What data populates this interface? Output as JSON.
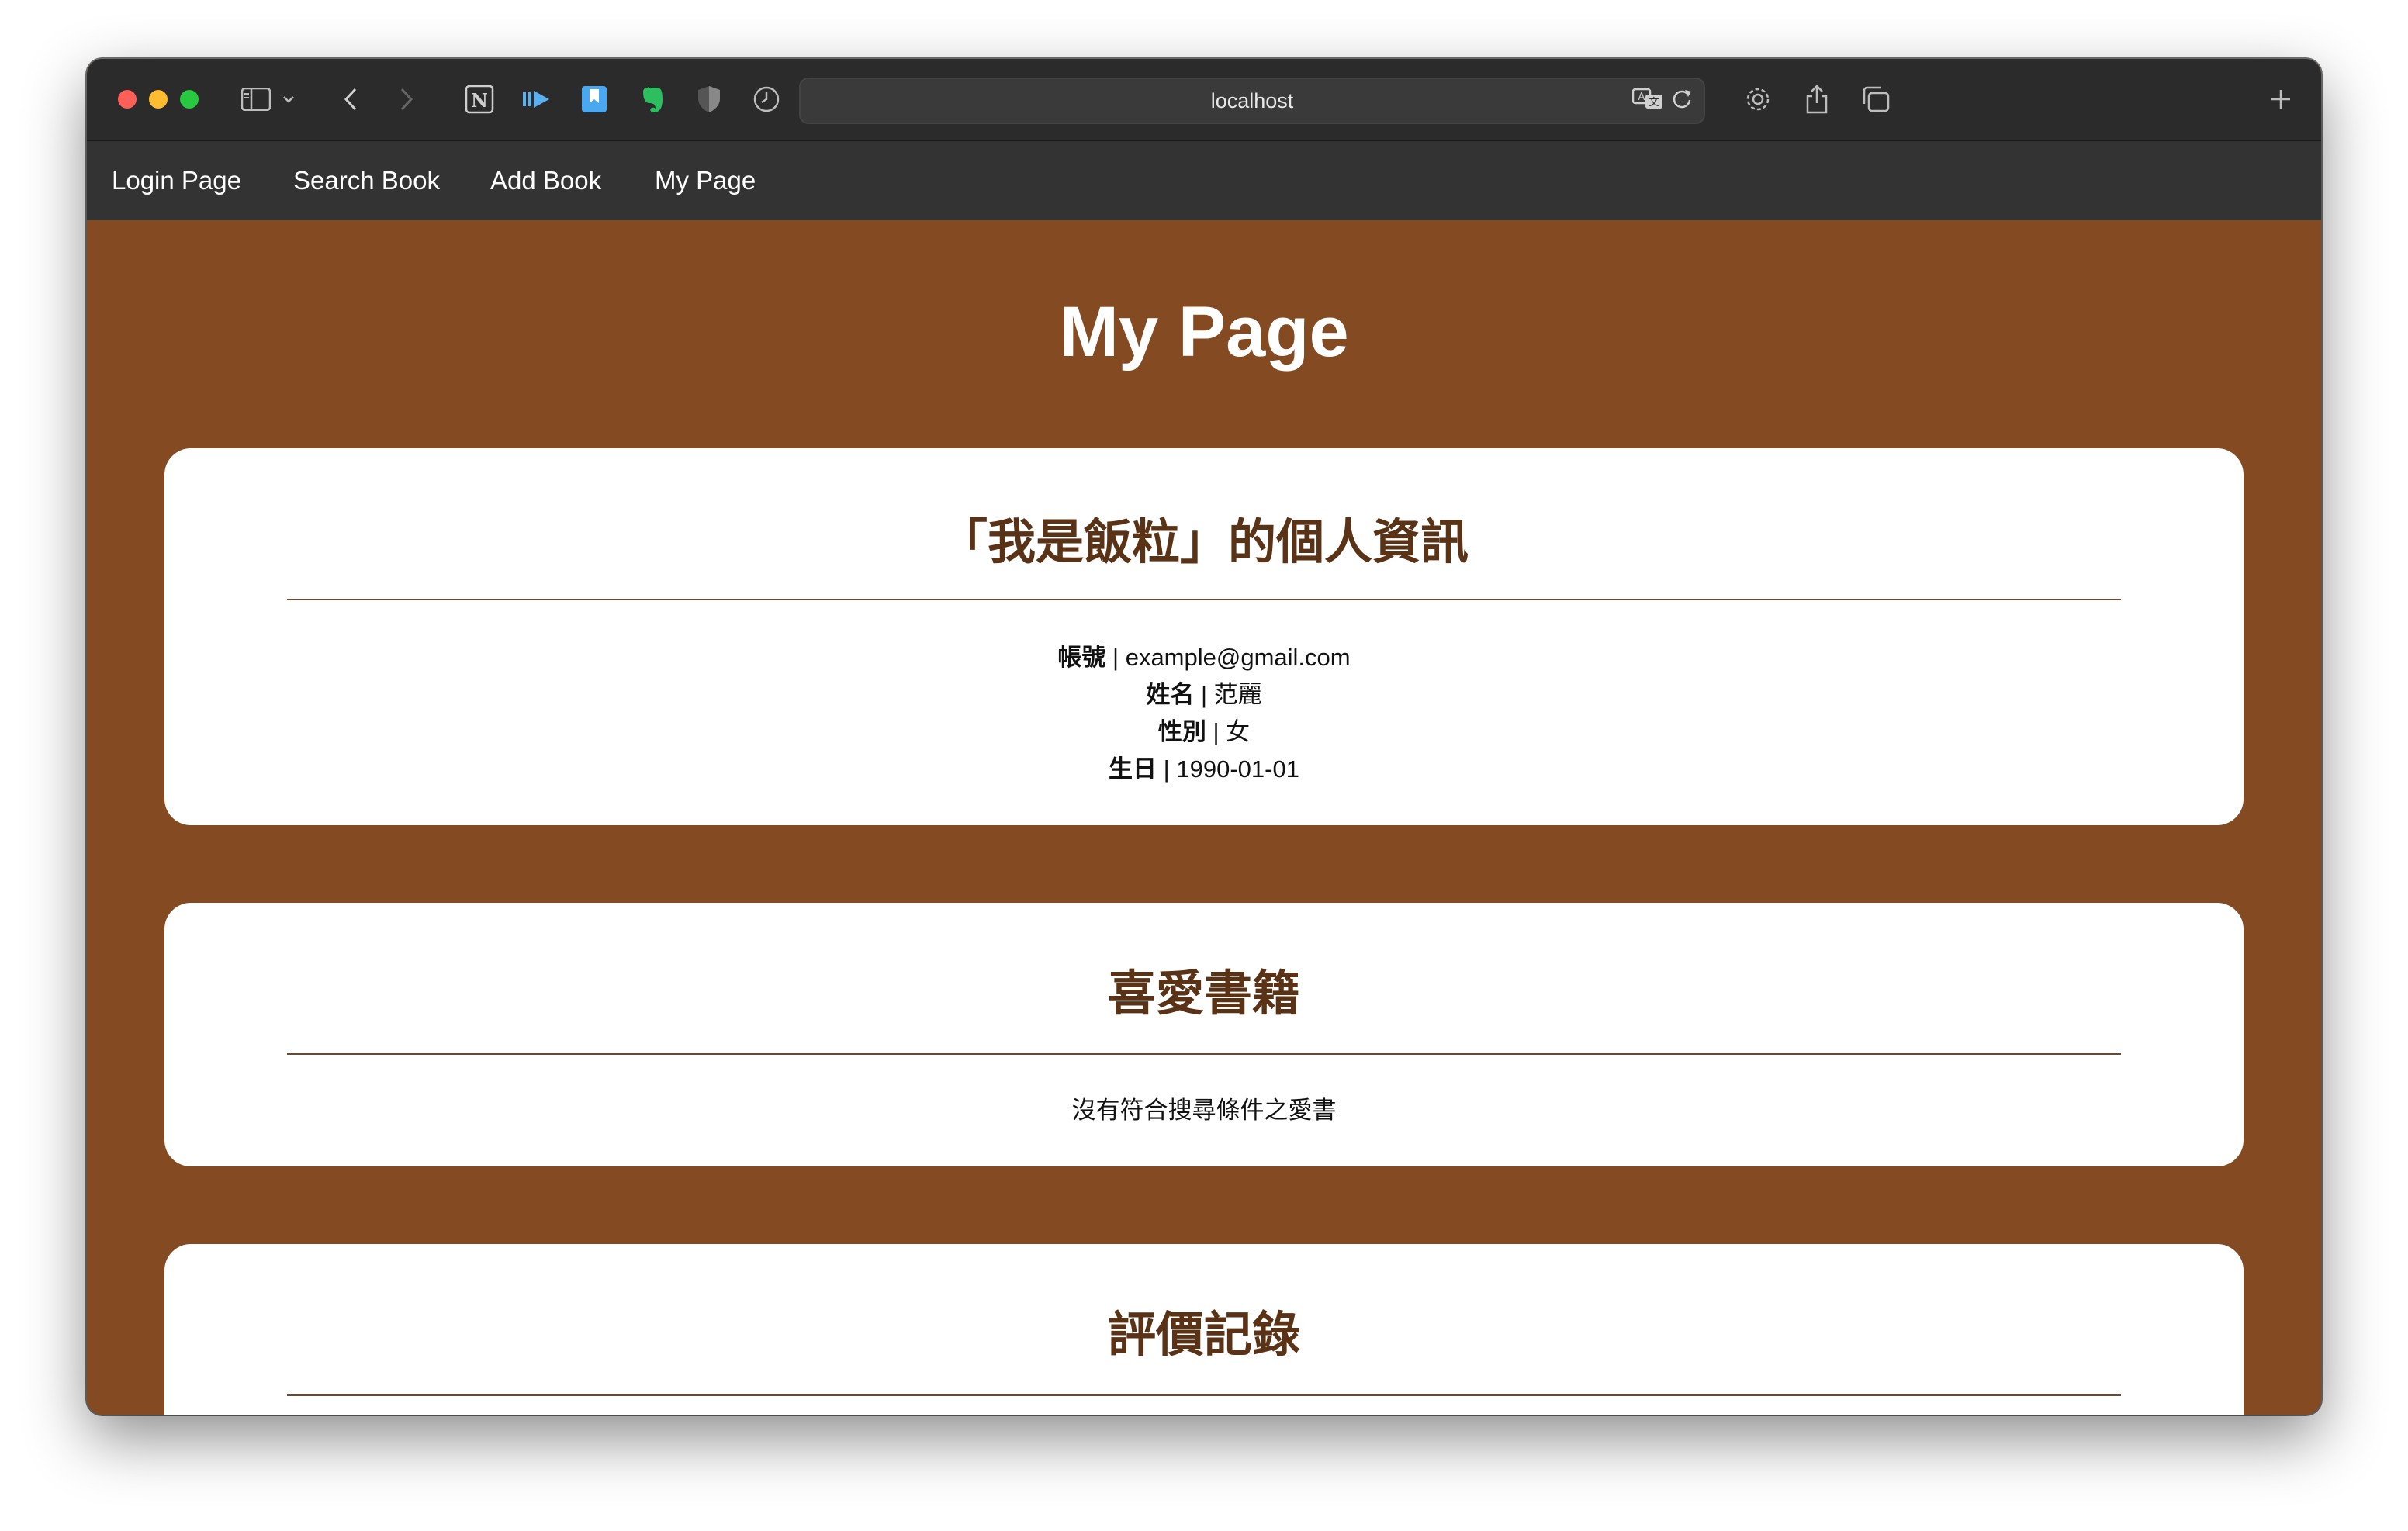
{
  "browser": {
    "url": "localhost",
    "icons": [
      "sidebar-toggle-icon",
      "chevron-down-icon",
      "back-arrow-icon",
      "forward-arrow-icon",
      "notion-icon",
      "playback-icon",
      "bookmark-icon",
      "evernote-icon",
      "shield-icon",
      "history-clock-icon",
      "translate-icon",
      "reload-icon",
      "settings-gear-icon",
      "share-icon",
      "tabs-overview-icon",
      "new-tab-plus-icon"
    ]
  },
  "nav": {
    "login": "Login Page",
    "search": "Search Book",
    "add": "Add Book",
    "mypage": "My Page"
  },
  "page": {
    "title": "My Page"
  },
  "profile": {
    "title": "「我是飯粒」的個人資訊",
    "account_label": "帳號",
    "account_value": "example@gmail.com",
    "name_label": "姓名",
    "name_value": "范麗",
    "gender_label": "性別",
    "gender_value": "女",
    "birthday_label": "生日",
    "birthday_value": "1990-01-01",
    "separator": "|"
  },
  "favorites": {
    "title": "喜愛書籍",
    "empty": "沒有符合搜尋條件之愛書"
  },
  "reviews": {
    "title": "評價記錄"
  },
  "colors": {
    "page_bg": "#844a21",
    "nav_bg": "#333333",
    "heading_brown": "#5a3317",
    "card_bg": "#ffffff"
  }
}
